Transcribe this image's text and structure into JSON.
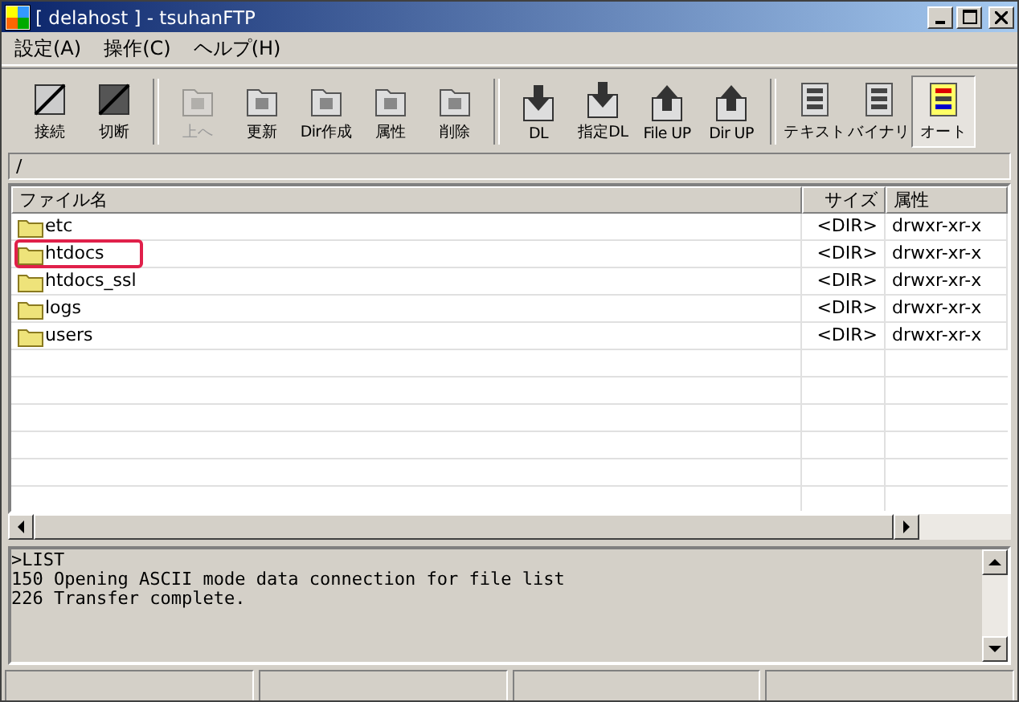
{
  "window": {
    "title": "[ delahost ] - tsuhanFTP"
  },
  "menu": [
    "設定(A)",
    "操作(C)",
    "ヘルプ(H)"
  ],
  "toolbar": {
    "groups": [
      [
        {
          "label": "接続",
          "disabled": false,
          "pressed": false
        },
        {
          "label": "切断",
          "disabled": false,
          "pressed": false
        }
      ],
      [
        {
          "label": "上へ",
          "disabled": true,
          "pressed": false
        },
        {
          "label": "更新",
          "disabled": false,
          "pressed": false
        },
        {
          "label": "Dir作成",
          "disabled": false,
          "pressed": false
        },
        {
          "label": "属性",
          "disabled": false,
          "pressed": false
        },
        {
          "label": "削除",
          "disabled": false,
          "pressed": false
        }
      ],
      [
        {
          "label": "DL",
          "disabled": false,
          "pressed": false
        },
        {
          "label": "指定DL",
          "disabled": false,
          "pressed": false
        },
        {
          "label": "File UP",
          "disabled": false,
          "pressed": false
        },
        {
          "label": "Dir UP",
          "disabled": false,
          "pressed": false
        }
      ],
      [
        {
          "label": "テキスト",
          "disabled": false,
          "pressed": false
        },
        {
          "label": "バイナリ",
          "disabled": false,
          "pressed": false
        },
        {
          "label": "オート",
          "disabled": false,
          "pressed": true
        }
      ]
    ]
  },
  "path": "/",
  "table": {
    "columns": [
      "ファイル名",
      "サイズ",
      "属性"
    ],
    "rows": [
      {
        "name": "etc",
        "size": "<DIR>",
        "attributes": "drwxr-xr-x",
        "circled": false
      },
      {
        "name": "htdocs",
        "size": "<DIR>",
        "attributes": "drwxr-xr-x",
        "circled": true
      },
      {
        "name": "htdocs_ssl",
        "size": "<DIR>",
        "attributes": "drwxr-xr-x",
        "circled": false
      },
      {
        "name": "logs",
        "size": "<DIR>",
        "attributes": "drwxr-xr-x",
        "circled": false
      },
      {
        "name": "users",
        "size": "<DIR>",
        "attributes": "drwxr-xr-x",
        "circled": false
      }
    ]
  },
  "log": [
    ">LIST",
    "150 Opening ASCII mode data connection for file list",
    "226 Transfer complete."
  ]
}
